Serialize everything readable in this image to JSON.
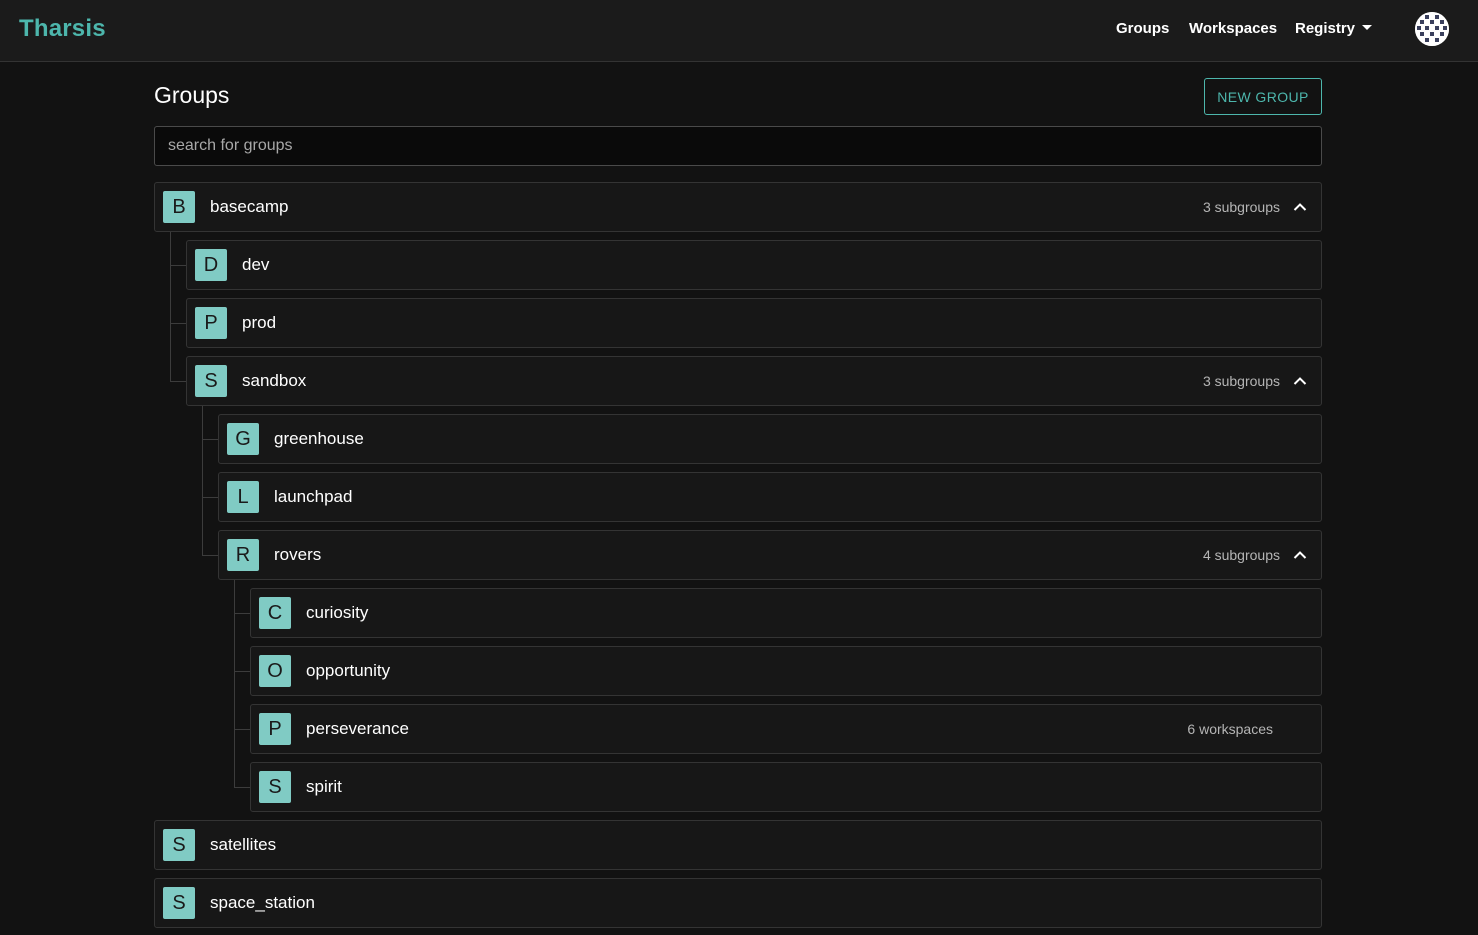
{
  "app": {
    "brand": "Tharsis"
  },
  "nav": {
    "groups": "Groups",
    "workspaces": "Workspaces",
    "registry": "Registry"
  },
  "page": {
    "title": "Groups",
    "new_button": "NEW GROUP",
    "search_placeholder": "search for groups"
  },
  "rows": [
    {
      "letter": "B",
      "name": "basecamp",
      "count": "3 subgroups",
      "expanded": true
    },
    {
      "letter": "D",
      "name": "dev",
      "count": ""
    },
    {
      "letter": "P",
      "name": "prod",
      "count": ""
    },
    {
      "letter": "S",
      "name": "sandbox",
      "count": "3 subgroups",
      "expanded": true
    },
    {
      "letter": "G",
      "name": "greenhouse",
      "count": ""
    },
    {
      "letter": "L",
      "name": "launchpad",
      "count": ""
    },
    {
      "letter": "R",
      "name": "rovers",
      "count": "4 subgroups",
      "expanded": true
    },
    {
      "letter": "C",
      "name": "curiosity",
      "count": ""
    },
    {
      "letter": "O",
      "name": "opportunity",
      "count": ""
    },
    {
      "letter": "P",
      "name": "perseverance",
      "count": "6 workspaces"
    },
    {
      "letter": "S",
      "name": "spirit",
      "count": ""
    },
    {
      "letter": "S",
      "name": "satellites",
      "count": ""
    },
    {
      "letter": "S",
      "name": "space_station",
      "count": ""
    }
  ],
  "colors": {
    "accent": "#4db6ac",
    "avatar_tile": "#80cbc4",
    "background": "#121212"
  },
  "icons": {
    "expand": "chevron-up-icon",
    "registry": "caret-down-icon",
    "user": "avatar-icon"
  }
}
